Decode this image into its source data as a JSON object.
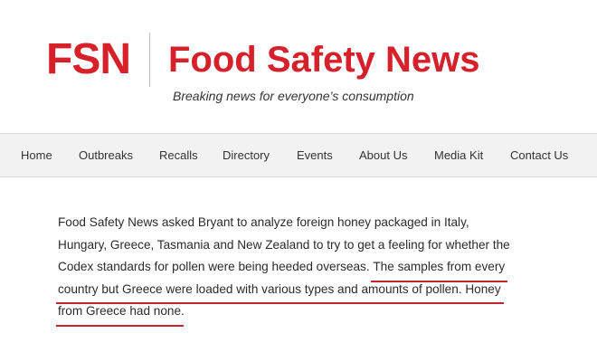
{
  "header": {
    "logo_text": "FSN",
    "site_title": "Food Safety News",
    "tagline": "Breaking news for everyone’s consumption"
  },
  "nav": {
    "items": [
      {
        "label": "Home"
      },
      {
        "label": "Outbreaks"
      },
      {
        "label": "Recalls"
      },
      {
        "label": "Directory"
      },
      {
        "label": "Events"
      },
      {
        "label": "About Us"
      },
      {
        "label": "Media Kit"
      },
      {
        "label": "Contact Us"
      }
    ]
  },
  "article": {
    "line1": "Food Safety News asked Bryant to analyze foreign honey packaged in Italy,",
    "line2": "Hungary, Greece, Tasmania and New Zealand to try to get a feeling for whether the",
    "line3_plain": "Codex standards for pollen were being heeded overseas. ",
    "line3_highlight": "The samples from every",
    "line4_highlight": "country but Greece were loaded with various types and amounts of pollen. Honey",
    "line5_highlight": "from Greece had none",
    "line5_plain": "."
  },
  "colors": {
    "brand_red": "#d6202a",
    "underline_red": "#c0262e",
    "nav_background": "#f2f2f2"
  }
}
